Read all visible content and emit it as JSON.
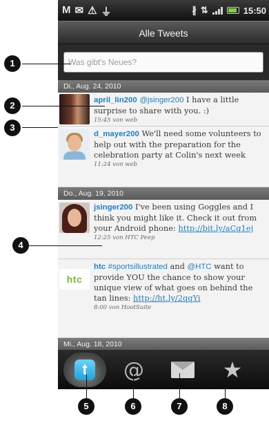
{
  "status_bar": {
    "left_icons": [
      "gmail-icon",
      "mail-icon",
      "warning-icon",
      "usb-icon"
    ],
    "right_icons": [
      "bluetooth-icon",
      "data-icon",
      "signal-icon",
      "battery-icon"
    ],
    "time": "15:50",
    "colors": {
      "battery": "#7bd33b"
    }
  },
  "title_bar": {
    "title": "Alle Tweets"
  },
  "compose": {
    "placeholder": "Was gibt's Neues?"
  },
  "date_headers": [
    "Di., Aug. 24, 2010",
    "Do., Aug. 19, 2010",
    "Mi., Aug. 18, 2010"
  ],
  "tweets": [
    {
      "user": "april_lin200",
      "mention": "@jsinger200",
      "text": " I have a little surprise to share with you. :)",
      "meta": "15:45 von web"
    },
    {
      "user": "d_mayer200",
      "text": " We'll need some volunteers to help out with the preparation for the celebration party at Colin's next week",
      "meta": "11:24 von web"
    },
    {
      "user": "jsinger200",
      "text": " I've been using Goggles and I think you might like it. Check it out from your Android phone: ",
      "link": "http://bit.ly/aCq1ej",
      "meta": "12:25 von  HTC Peep"
    },
    {
      "user": "htc",
      "avatar_text": "htc",
      "hashtag": "#sportsillustrated",
      "text_a": " and ",
      "mention": "@HTC",
      "text_b": " want to provide YOU the chance to show your unique view of what goes on behind the tan lines: ",
      "link": "http://ht.ly/2qqYi",
      "meta": "8:00 von HootSuite"
    }
  ],
  "tabs": [
    {
      "name": "twitter-tab",
      "icon": "twitter-logo-icon",
      "glyph": "t"
    },
    {
      "name": "mentions-tab",
      "icon": "at-icon",
      "glyph": "@"
    },
    {
      "name": "messages-tab",
      "icon": "envelope-icon",
      "glyph": ""
    },
    {
      "name": "favorites-tab",
      "icon": "star-icon",
      "glyph": "★"
    }
  ],
  "callouts": [
    "1",
    "2",
    "3",
    "4",
    "5",
    "6",
    "7",
    "8"
  ],
  "colors": {
    "link": "#1e7fc4",
    "htc_green": "#7db43a",
    "twitter_blue": "#1ea3dd"
  }
}
